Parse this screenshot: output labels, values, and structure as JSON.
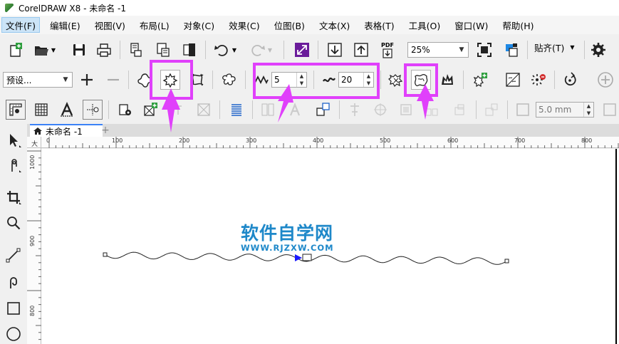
{
  "window": {
    "title": "CorelDRAW X8 - 未命名 -1"
  },
  "menubar": {
    "items": [
      {
        "label": "文件(F)",
        "active": true
      },
      {
        "label": "编辑(E)"
      },
      {
        "label": "视图(V)"
      },
      {
        "label": "布局(L)"
      },
      {
        "label": "对象(C)"
      },
      {
        "label": "效果(C)"
      },
      {
        "label": "位图(B)"
      },
      {
        "label": "文本(X)"
      },
      {
        "label": "表格(T)"
      },
      {
        "label": "工具(O)"
      },
      {
        "label": "窗口(W)"
      },
      {
        "label": "帮助(H)"
      }
    ]
  },
  "toolbar": {
    "zoom_value": "25%",
    "paste_to_label": "贴齐(T)",
    "pdf_label": "PDF"
  },
  "property_bar": {
    "preset_value": "预设...",
    "frequency_value": "5",
    "amplitude_value": "20"
  },
  "object_bar": {
    "outline_width_value": "5.0 mm"
  },
  "document": {
    "tab_label": "未命名 -1",
    "add_tab_label": "+"
  },
  "ruler": {
    "unit_glyph": "大",
    "h_labels": [
      "0",
      "100",
      "200",
      "300",
      "400",
      "500",
      "600",
      "700",
      "800"
    ],
    "v_labels": [
      "1000",
      "900",
      "800"
    ]
  },
  "watermark": {
    "title": "软件自学网",
    "subtitle": "WWW.RJZXW.COM"
  },
  "colors": {
    "highlight": "#e040fb",
    "watermark": "#1e88c9",
    "active_menu": "#cce4f7",
    "tab_accent": "#3b82f6"
  },
  "icons": [
    "new-document-icon",
    "open-folder-icon",
    "save-icon",
    "print-icon",
    "import-icon",
    "export-icon",
    "undo-icon",
    "redo-icon",
    "publish-pdf-icon",
    "full-screen-icon",
    "options-gear-icon",
    "add-icon",
    "remove-icon",
    "pucker-bloat-icon",
    "zipper-distortion-icon",
    "twister-distortion-icon",
    "pick-tool-icon",
    "freehand-pick-icon",
    "crop-icon",
    "zoom-icon",
    "line-tool-icon",
    "curve-tool-icon",
    "rectangle-tool-icon",
    "ellipse-tool-icon"
  ]
}
